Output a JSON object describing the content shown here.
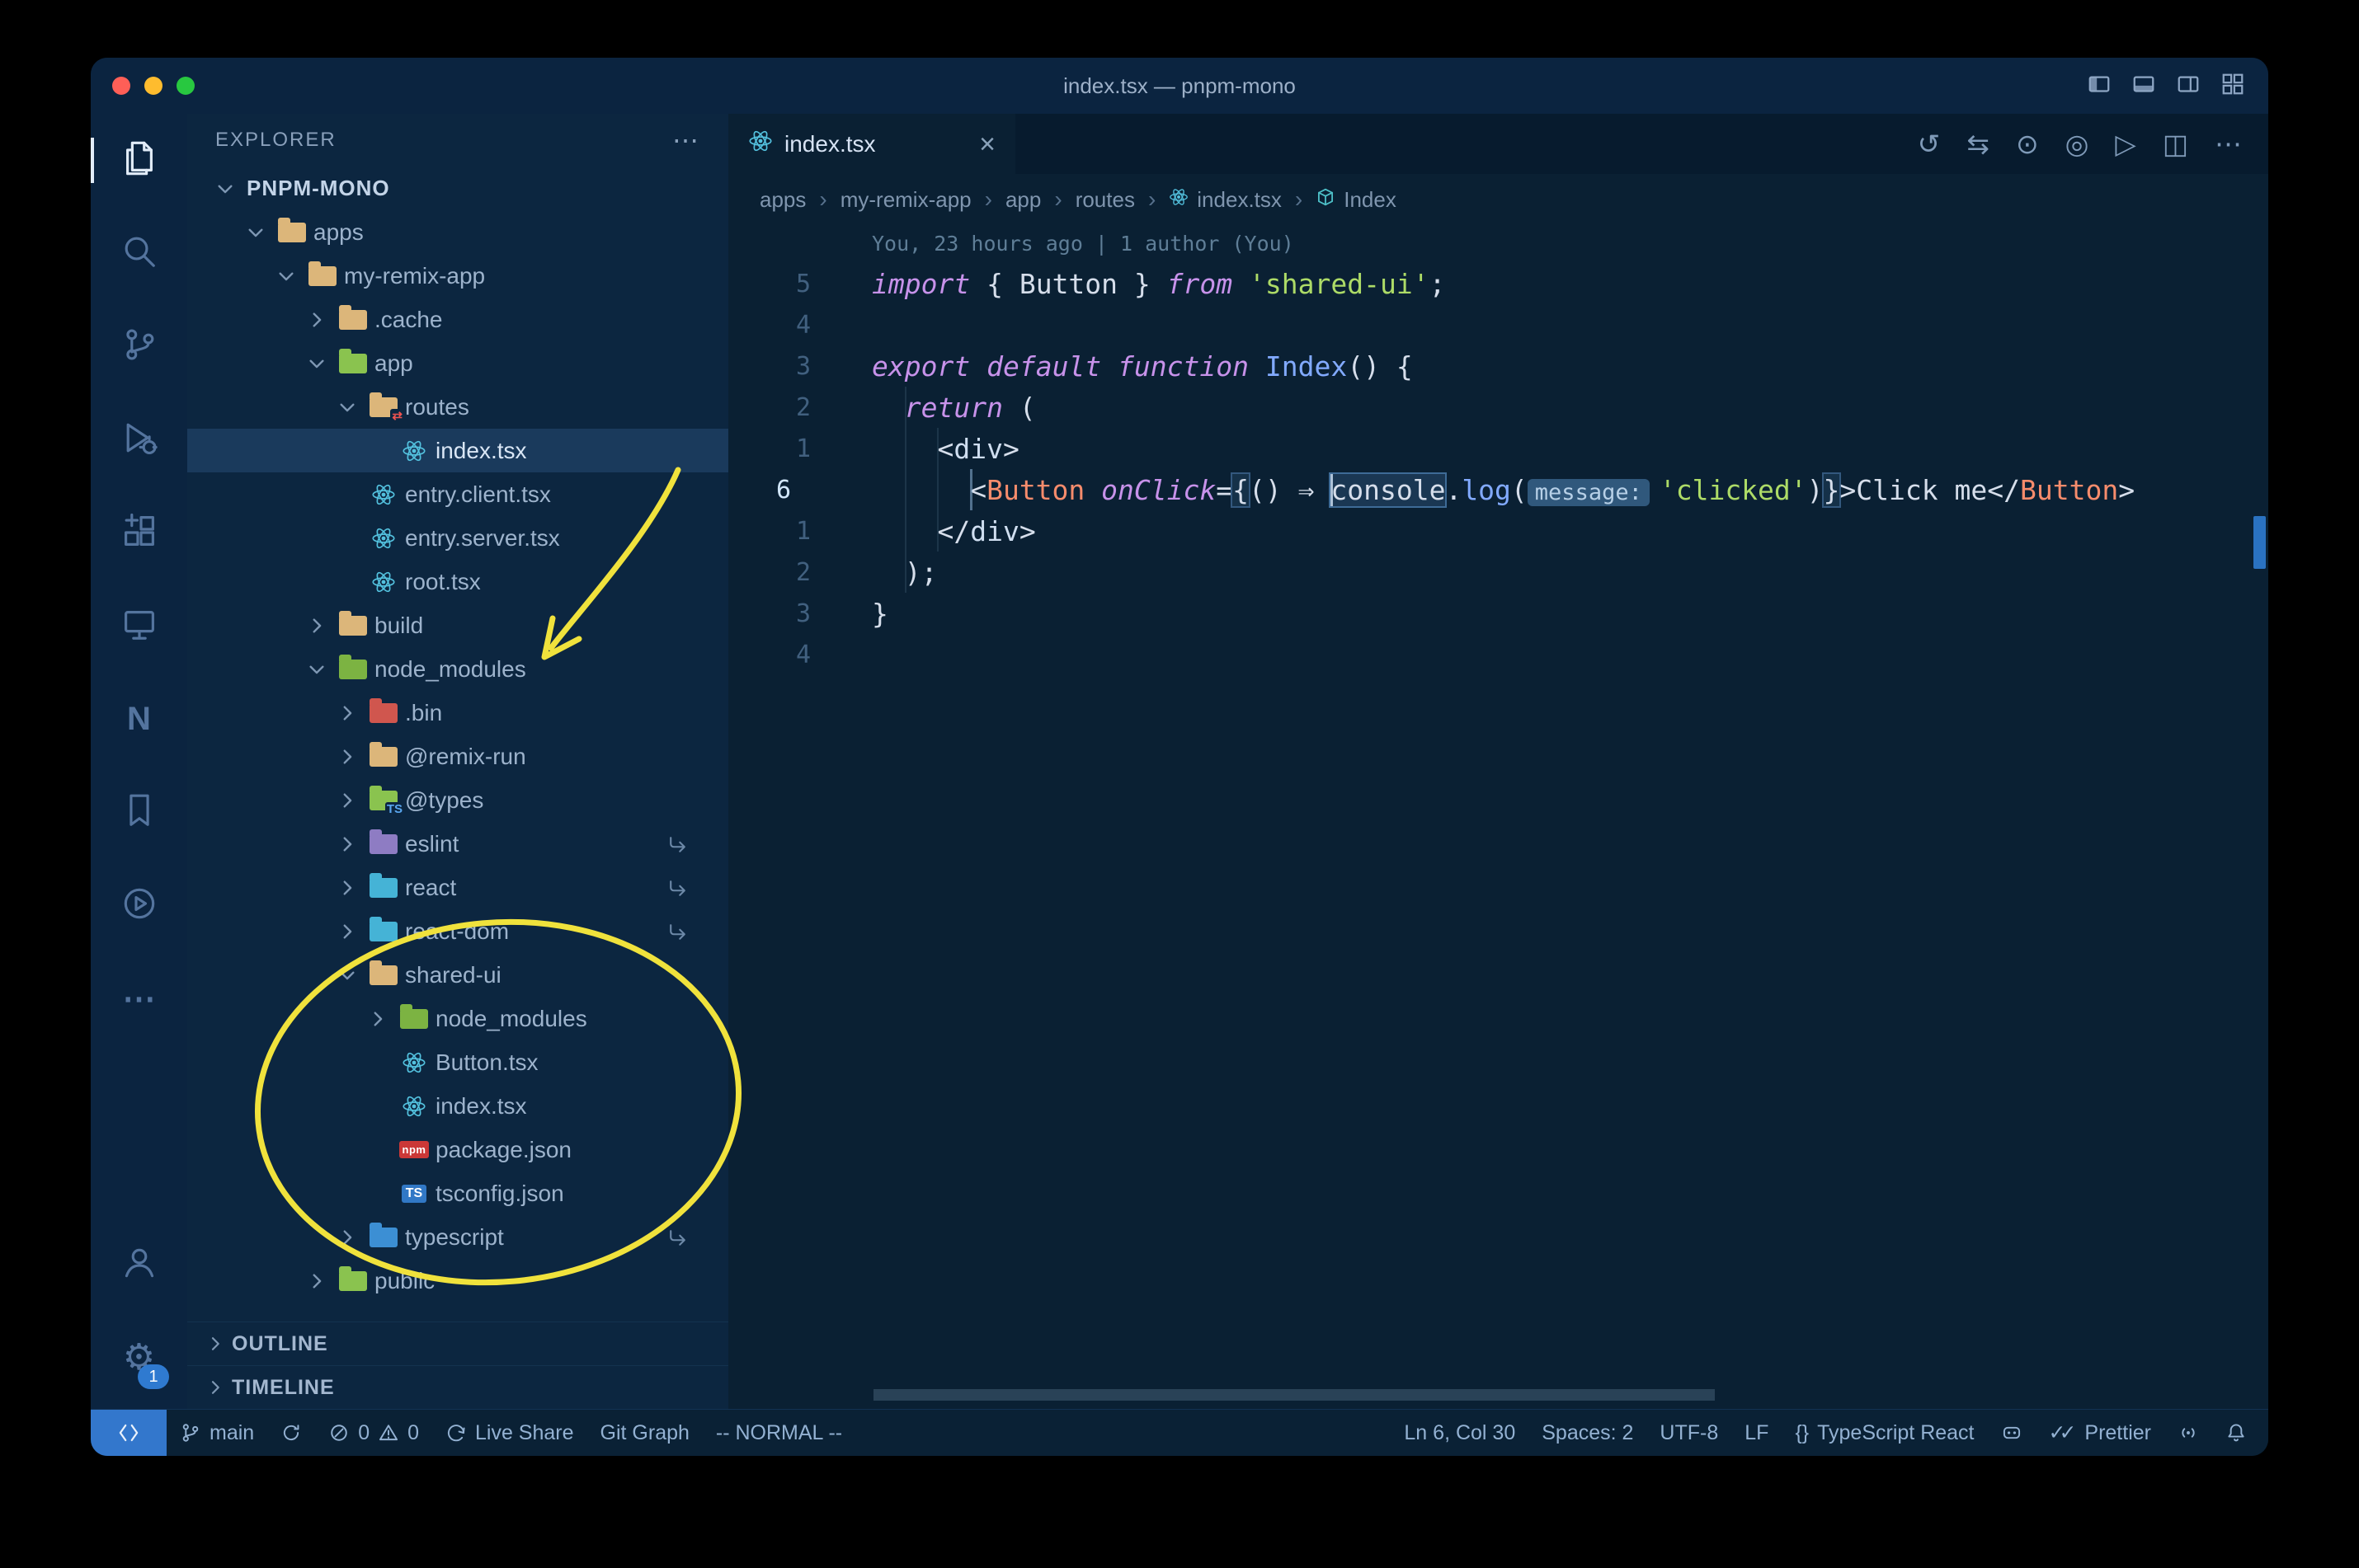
{
  "window": {
    "title": "index.tsx — pnpm-mono"
  },
  "layout_controls": [
    {
      "name": "toggle-primary-sidebar"
    },
    {
      "name": "toggle-panel"
    },
    {
      "name": "toggle-secondary-sidebar"
    },
    {
      "name": "customize-layout"
    }
  ],
  "activity_bar": {
    "top": [
      {
        "name": "explorer",
        "icon": "explorer",
        "active": true
      },
      {
        "name": "search",
        "icon": "search"
      },
      {
        "name": "source-control",
        "icon": "scm"
      },
      {
        "name": "run-and-debug",
        "icon": "debug"
      },
      {
        "name": "extensions",
        "icon": "ext"
      },
      {
        "name": "remote-explorer",
        "icon": "remote-win"
      },
      {
        "name": "nx-console",
        "glyph": "N"
      },
      {
        "name": "bookmarks",
        "icon": "bookmark"
      },
      {
        "name": "live-server",
        "icon": "playcircle"
      },
      {
        "name": "more-views",
        "glyph": "⋯"
      }
    ],
    "bottom": [
      {
        "name": "accounts",
        "icon": "accounts"
      },
      {
        "name": "manage",
        "glyph": "⚙",
        "badge": "1"
      }
    ]
  },
  "sidebar": {
    "header": "EXPLORER",
    "header_more": "⋯",
    "tree": [
      {
        "label": "PNPM-MONO",
        "level": 0,
        "chevron": "down",
        "root": true
      },
      {
        "label": "apps",
        "level": 1,
        "chevron": "down",
        "ic": "folder",
        "color": "#dcb67a"
      },
      {
        "label": "my-remix-app",
        "level": 2,
        "chevron": "down",
        "ic": "folder",
        "color": "#dcb67a"
      },
      {
        "label": ".cache",
        "level": 3,
        "chevron": "right",
        "ic": "folder",
        "color": "#dcb67a"
      },
      {
        "label": "app",
        "level": 3,
        "chevron": "down",
        "ic": "folder",
        "color": "#8ac34f"
      },
      {
        "label": "routes",
        "level": 4,
        "chevron": "down",
        "ic": "folder",
        "color": "#dcb67a",
        "badge": "⇄",
        "badge_color": "#ef5350"
      },
      {
        "label": "index.tsx",
        "level": 5,
        "ic": "react",
        "selected": true
      },
      {
        "label": "entry.client.tsx",
        "level": 4,
        "ic": "react"
      },
      {
        "label": "entry.server.tsx",
        "level": 4,
        "ic": "react"
      },
      {
        "label": "root.tsx",
        "level": 4,
        "ic": "react"
      },
      {
        "label": "build",
        "level": 3,
        "chevron": "right",
        "ic": "folder",
        "color": "#dcb67a"
      },
      {
        "label": "node_modules",
        "level": 3,
        "chevron": "down",
        "ic": "folder",
        "color": "#7cb342"
      },
      {
        "label": ".bin",
        "level": 4,
        "chevron": "right",
        "ic": "folder",
        "color": "#d0564e"
      },
      {
        "label": "@remix-run",
        "level": 4,
        "chevron": "right",
        "ic": "folder",
        "color": "#dcb67a"
      },
      {
        "label": "@types",
        "level": 4,
        "chevron": "right",
        "ic": "folder",
        "color": "#8ac34f",
        "badge": "TS",
        "badge_color": "#5aa7f0"
      },
      {
        "label": "eslint",
        "level": 4,
        "chevron": "right",
        "ic": "folder",
        "color": "#8e7cc3",
        "symlink": true
      },
      {
        "label": "react",
        "level": 4,
        "chevron": "right",
        "ic": "folder",
        "color": "#45b3d6",
        "symlink": true
      },
      {
        "label": "react-dom",
        "level": 4,
        "chevron": "right",
        "ic": "folder",
        "color": "#45b3d6",
        "symlink": true
      },
      {
        "label": "shared-ui",
        "level": 4,
        "chevron": "down",
        "ic": "folder",
        "color": "#dcb67a"
      },
      {
        "label": "node_modules",
        "level": 5,
        "chevron": "right",
        "ic": "folder",
        "color": "#7cb342"
      },
      {
        "label": "Button.tsx",
        "level": 5,
        "ic": "react"
      },
      {
        "label": "index.tsx",
        "level": 5,
        "ic": "react"
      },
      {
        "label": "package.json",
        "level": 5,
        "ic": "npm"
      },
      {
        "label": "tsconfig.json",
        "level": 5,
        "ic": "ts"
      },
      {
        "label": "typescript",
        "level": 4,
        "chevron": "right",
        "ic": "folder",
        "color": "#3c8fd4",
        "symlink": true
      },
      {
        "label": "public",
        "level": 3,
        "chevron": "right",
        "ic": "folder",
        "color": "#8ac34f"
      }
    ],
    "sections": [
      {
        "label": "OUTLINE"
      },
      {
        "label": "TIMELINE"
      }
    ]
  },
  "icon_text": {
    "npm": "npm",
    "ts": "TS"
  },
  "editor": {
    "tab": {
      "label": "index.tsx",
      "icon": "react",
      "close": "×"
    },
    "actions": [
      {
        "name": "local-history",
        "glyph": "↺"
      },
      {
        "name": "open-changes",
        "glyph": "⇆"
      },
      {
        "name": "go-to-symbol",
        "glyph": "⊙"
      },
      {
        "name": "toggle-preview",
        "glyph": "◎"
      },
      {
        "name": "run-file",
        "glyph": "▷"
      },
      {
        "name": "split-editor",
        "glyph": "◫"
      },
      {
        "name": "more-actions",
        "glyph": "⋯"
      }
    ],
    "breadcrumbs": [
      {
        "label": "apps"
      },
      {
        "label": "my-remix-app"
      },
      {
        "label": "app"
      },
      {
        "label": "routes"
      },
      {
        "label": "index.tsx",
        "icon": "react"
      },
      {
        "label": "Index",
        "icon": "cube"
      }
    ],
    "codelens": "You, 23 hours ago | 1 author (You)",
    "lines": [
      {
        "gutter": "5",
        "tokens": [
          [
            "k",
            "import"
          ],
          [
            "p",
            " { "
          ],
          [
            "p",
            "Button"
          ],
          [
            "p",
            " } "
          ],
          [
            "k",
            "from"
          ],
          [
            "p",
            " "
          ],
          [
            "s",
            "'shared-ui'"
          ],
          [
            "p",
            ";"
          ]
        ]
      },
      {
        "gutter": "4",
        "tokens": []
      },
      {
        "gutter": "3",
        "tokens": [
          [
            "k",
            "export"
          ],
          [
            "p",
            " "
          ],
          [
            "k",
            "default"
          ],
          [
            "p",
            " "
          ],
          [
            "k",
            "function"
          ],
          [
            "p",
            " "
          ],
          [
            "f",
            "Index"
          ],
          [
            "p",
            "() {"
          ]
        ]
      },
      {
        "gutter": "2",
        "tokens": [
          [
            "p",
            "  "
          ],
          [
            "k",
            "return"
          ],
          [
            "p",
            " ("
          ]
        ]
      },
      {
        "gutter": "1",
        "tokens": [
          [
            "p",
            "    <"
          ],
          [
            "t",
            "div"
          ],
          [
            "p",
            ">"
          ]
        ]
      },
      {
        "gutter": "6",
        "current": true,
        "tokens": [
          [
            "p",
            "      <"
          ],
          [
            "c",
            "Button"
          ],
          [
            "p",
            " "
          ],
          [
            "a",
            "onClick"
          ],
          [
            "p",
            "="
          ],
          [
            "pb",
            "{"
          ],
          [
            "p",
            "() "
          ],
          [
            "ar",
            "⇒"
          ],
          [
            "p",
            " "
          ],
          [
            "cur",
            ""
          ],
          [
            "pw",
            "console"
          ],
          [
            "p",
            "."
          ],
          [
            "f",
            "log"
          ],
          [
            "p",
            "("
          ],
          [
            "i",
            "message:"
          ],
          [
            "s",
            "'clicked'"
          ],
          [
            "p",
            ")"
          ],
          [
            "pb",
            "}"
          ],
          [
            "p",
            ">"
          ],
          [
            "p",
            "Click me"
          ],
          [
            "p",
            "</"
          ],
          [
            "c",
            "Button"
          ],
          [
            "p",
            ">"
          ]
        ]
      },
      {
        "gutter": "1",
        "tokens": [
          [
            "p",
            "    </"
          ],
          [
            "t",
            "div"
          ],
          [
            "p",
            ">"
          ]
        ]
      },
      {
        "gutter": "2",
        "tokens": [
          [
            "p",
            "  );"
          ]
        ]
      },
      {
        "gutter": "3",
        "tokens": [
          [
            "p",
            "}"
          ]
        ]
      },
      {
        "gutter": "4",
        "tokens": []
      }
    ]
  },
  "status_bar": {
    "left": [
      {
        "name": "remote",
        "icon": "remote"
      },
      {
        "name": "git-branch",
        "icon": "branch",
        "label": "main"
      },
      {
        "name": "sync",
        "icon": "sync"
      },
      {
        "name": "problems",
        "parts": [
          {
            "icon": "error",
            "label": "0"
          },
          {
            "icon": "warning",
            "label": "0"
          }
        ]
      },
      {
        "name": "live-share",
        "icon": "liveshare",
        "label": "Live Share"
      },
      {
        "name": "git-graph",
        "label": "Git Graph"
      },
      {
        "name": "vim-mode",
        "label": "-- NORMAL --"
      }
    ],
    "right": [
      {
        "name": "cursor-position",
        "label": "Ln 6, Col 30"
      },
      {
        "name": "indentation",
        "label": "Spaces: 2"
      },
      {
        "name": "encoding",
        "label": "UTF-8"
      },
      {
        "name": "eol",
        "label": "LF"
      },
      {
        "name": "language",
        "glyph": "{}",
        "label": "TypeScript React"
      },
      {
        "name": "copilot",
        "icon": "copilot"
      },
      {
        "name": "prettier",
        "glyph": "✓✓",
        "label": "Prettier"
      },
      {
        "name": "broadcast",
        "icon": "tower"
      },
      {
        "name": "notifications",
        "icon": "bell"
      }
    ]
  },
  "annotations": {
    "color": "#f0e23c",
    "items": [
      {
        "name": "arrow-to-node-modules"
      },
      {
        "name": "ellipse-around-shared-ui"
      }
    ]
  }
}
